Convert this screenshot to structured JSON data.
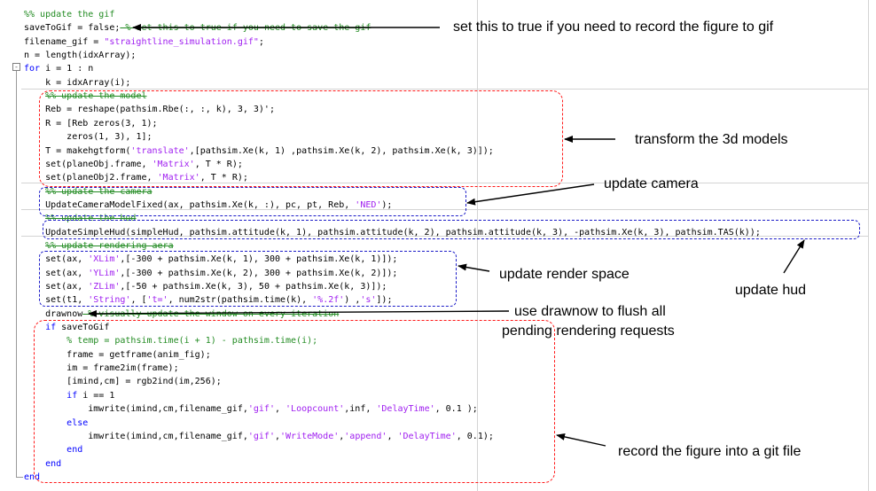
{
  "code_lines": [
    {
      "indent": "",
      "segments": [
        {
          "t": "%% update the gif",
          "c": "cmt"
        }
      ]
    },
    {
      "indent": "",
      "segments": [
        {
          "t": "saveToGif = ",
          "c": ""
        },
        {
          "t": "false",
          "c": ""
        },
        {
          "t": ";",
          "c": ""
        },
        {
          "t": " % set this to true if you need to save the gif",
          "c": "cmt strike"
        }
      ]
    },
    {
      "indent": "",
      "segments": [
        {
          "t": "filename_gif = ",
          "c": ""
        },
        {
          "t": "\"straightline_simulation.gif\"",
          "c": "str"
        },
        {
          "t": ";",
          "c": ""
        }
      ]
    },
    {
      "indent": "",
      "segments": [
        {
          "t": "n = length(idxArray);",
          "c": ""
        }
      ]
    },
    {
      "indent": "",
      "segments": [
        {
          "t": "for",
          "c": "kw"
        },
        {
          "t": " i = 1 : n",
          "c": ""
        }
      ]
    },
    {
      "indent": "    ",
      "segments": [
        {
          "t": "k = idxArray(i);",
          "c": ""
        }
      ]
    },
    {
      "indent": "    ",
      "segments": [
        {
          "t": "%% update the model",
          "c": "cmt strike"
        }
      ]
    },
    {
      "indent": "    ",
      "segments": [
        {
          "t": "Reb = reshape(pathsim.Rbe(:, :, k), 3, 3)';",
          "c": ""
        }
      ]
    },
    {
      "indent": "    ",
      "segments": [
        {
          "t": "R = [Reb zeros(3, 1);",
          "c": ""
        }
      ]
    },
    {
      "indent": "        ",
      "segments": [
        {
          "t": "zeros(1, 3), 1];",
          "c": ""
        }
      ]
    },
    {
      "indent": "    ",
      "segments": [
        {
          "t": "T = makehgtform(",
          "c": ""
        },
        {
          "t": "'translate'",
          "c": "str"
        },
        {
          "t": ",[pathsim.Xe(k, 1) ,pathsim.Xe(k, 2), pathsim.Xe(k, 3)]);",
          "c": ""
        }
      ]
    },
    {
      "indent": "    ",
      "segments": [
        {
          "t": "set(planeObj.frame, ",
          "c": ""
        },
        {
          "t": "'Matrix'",
          "c": "str"
        },
        {
          "t": ", T * R);",
          "c": ""
        }
      ]
    },
    {
      "indent": "    ",
      "segments": [
        {
          "t": "set(planeObj2.frame, ",
          "c": ""
        },
        {
          "t": "'Matrix'",
          "c": "str"
        },
        {
          "t": ", T * R);",
          "c": ""
        }
      ]
    },
    {
      "indent": "    ",
      "segments": [
        {
          "t": "%% update the camera",
          "c": "cmt strike"
        }
      ]
    },
    {
      "indent": "    ",
      "segments": [
        {
          "t": "UpdateCameraModelFixed(ax, pathsim.Xe(k, :), pc, pt, Reb, ",
          "c": ""
        },
        {
          "t": "'NED'",
          "c": "str"
        },
        {
          "t": ");",
          "c": ""
        }
      ]
    },
    {
      "indent": "    ",
      "segments": [
        {
          "t": "%% update the hud",
          "c": "cmt strike"
        }
      ]
    },
    {
      "indent": "    ",
      "segments": [
        {
          "t": "UpdateSimpleHud(simpleHud, pathsim.attitude(k, 1), pathsim.attitude(k, 2), pathsim.attitude(k, 3), -pathsim.Xe(k, 3), pathsim.TAS(k));",
          "c": ""
        }
      ]
    },
    {
      "indent": "    ",
      "segments": [
        {
          "t": "%% update rendering aera",
          "c": "cmt strike"
        }
      ]
    },
    {
      "indent": "    ",
      "segments": [
        {
          "t": "set(ax, ",
          "c": ""
        },
        {
          "t": "'XLim'",
          "c": "str"
        },
        {
          "t": ",[-300 + pathsim.Xe(k, 1), 300 + pathsim.Xe(k, 1)]);",
          "c": ""
        }
      ]
    },
    {
      "indent": "    ",
      "segments": [
        {
          "t": "set(ax, ",
          "c": ""
        },
        {
          "t": "'YLim'",
          "c": "str"
        },
        {
          "t": ",[-300 + pathsim.Xe(k, 2), 300 + pathsim.Xe(k, 2)]);",
          "c": ""
        }
      ]
    },
    {
      "indent": "    ",
      "segments": [
        {
          "t": "set(ax, ",
          "c": ""
        },
        {
          "t": "'ZLim'",
          "c": "str"
        },
        {
          "t": ",[-50 + pathsim.Xe(k, 3), 50 + pathsim.Xe(k, 3)]);",
          "c": ""
        }
      ]
    },
    {
      "indent": "    ",
      "segments": [
        {
          "t": "set(t1, ",
          "c": ""
        },
        {
          "t": "'String'",
          "c": "str"
        },
        {
          "t": ", [",
          "c": ""
        },
        {
          "t": "'t='",
          "c": "str"
        },
        {
          "t": ", num2str(pathsim.time(k), ",
          "c": ""
        },
        {
          "t": "'%.2f'",
          "c": "str"
        },
        {
          "t": ") ,",
          "c": ""
        },
        {
          "t": "'s'",
          "c": "str"
        },
        {
          "t": "]);",
          "c": ""
        }
      ]
    },
    {
      "indent": "    ",
      "segments": [
        {
          "t": "drawnow",
          "c": ""
        },
        {
          "t": " % visually update the window on every iteration",
          "c": "cmt strike"
        }
      ]
    },
    {
      "indent": "    ",
      "segments": [
        {
          "t": "if",
          "c": "kw"
        },
        {
          "t": " saveToGif",
          "c": ""
        }
      ]
    },
    {
      "indent": "        ",
      "segments": [
        {
          "t": "% temp = pathsim.time(i + 1) - pathsim.time(i);",
          "c": "cmt"
        }
      ]
    },
    {
      "indent": "        ",
      "segments": [
        {
          "t": "frame = getframe(anim_fig);",
          "c": ""
        }
      ]
    },
    {
      "indent": "        ",
      "segments": [
        {
          "t": "im = frame2im(frame);",
          "c": ""
        }
      ]
    },
    {
      "indent": "        ",
      "segments": [
        {
          "t": "[imind,cm] = rgb2ind(im,256);",
          "c": ""
        }
      ]
    },
    {
      "indent": "        ",
      "segments": [
        {
          "t": "if",
          "c": "kw"
        },
        {
          "t": " i == 1",
          "c": ""
        }
      ]
    },
    {
      "indent": "            ",
      "segments": [
        {
          "t": "imwrite(imind,cm,filename_gif,",
          "c": ""
        },
        {
          "t": "'gif'",
          "c": "str"
        },
        {
          "t": ", ",
          "c": ""
        },
        {
          "t": "'Loopcount'",
          "c": "str"
        },
        {
          "t": ",inf, ",
          "c": ""
        },
        {
          "t": "'DelayTime'",
          "c": "str"
        },
        {
          "t": ", 0.1 );",
          "c": ""
        }
      ]
    },
    {
      "indent": "        ",
      "segments": [
        {
          "t": "else",
          "c": "kw"
        }
      ]
    },
    {
      "indent": "            ",
      "segments": [
        {
          "t": "imwrite(imind,cm,filename_gif,",
          "c": ""
        },
        {
          "t": "'gif'",
          "c": "str"
        },
        {
          "t": ",",
          "c": ""
        },
        {
          "t": "'WriteMode'",
          "c": "str"
        },
        {
          "t": ",",
          "c": ""
        },
        {
          "t": "'append'",
          "c": "str"
        },
        {
          "t": ", ",
          "c": ""
        },
        {
          "t": "'DelayTime'",
          "c": "str"
        },
        {
          "t": ", 0.1);",
          "c": ""
        }
      ]
    },
    {
      "indent": "        ",
      "segments": [
        {
          "t": "end",
          "c": "kw"
        }
      ]
    },
    {
      "indent": "    ",
      "segments": [
        {
          "t": "end",
          "c": "kw"
        }
      ]
    },
    {
      "indent": "",
      "segments": [
        {
          "t": "end",
          "c": "kw"
        }
      ]
    }
  ],
  "annotations": {
    "save_gif": "set this to true if you need to record the figure to gif",
    "transform": "transform the 3d models",
    "camera": "update camera",
    "render_space": "update render space",
    "hud": "update hud",
    "drawnow_line1": "use drawnow to flush all",
    "drawnow_line2": "pending rendering requests",
    "record": "record the figure into a git file"
  },
  "fold_marker": "-",
  "colors": {
    "keyword": "#0000ff",
    "string": "#a020f0",
    "comment": "#228b22",
    "red_box": "#ff1a1a",
    "blue_box": "#1c1cc8"
  }
}
